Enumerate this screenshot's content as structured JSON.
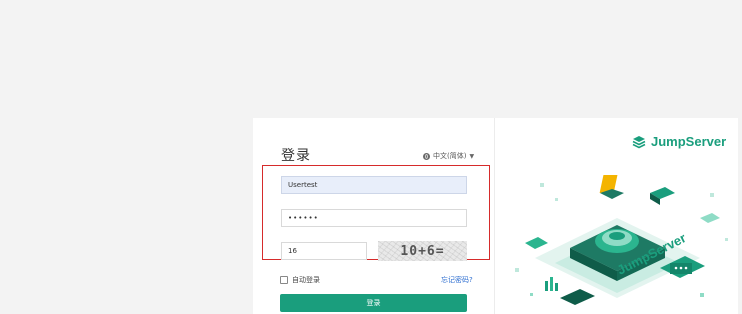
{
  "login": {
    "title": "登录",
    "language": "中文(简体)",
    "username_value": "Usertest",
    "password_value": "••••••",
    "captcha_value": "16",
    "captcha_image_text": "10+6=",
    "remember_label": "自动登录",
    "forgot_label": "忘记密码?",
    "submit_label": "登录"
  },
  "brand": {
    "logo_text": "JumpServer",
    "illustration_text": "JumpServer",
    "accent_color": "#1a9e7d"
  },
  "icons": [
    "globe-icon",
    "chevron-down-icon",
    "jumpserver-logo-icon",
    "checkbox-icon"
  ]
}
